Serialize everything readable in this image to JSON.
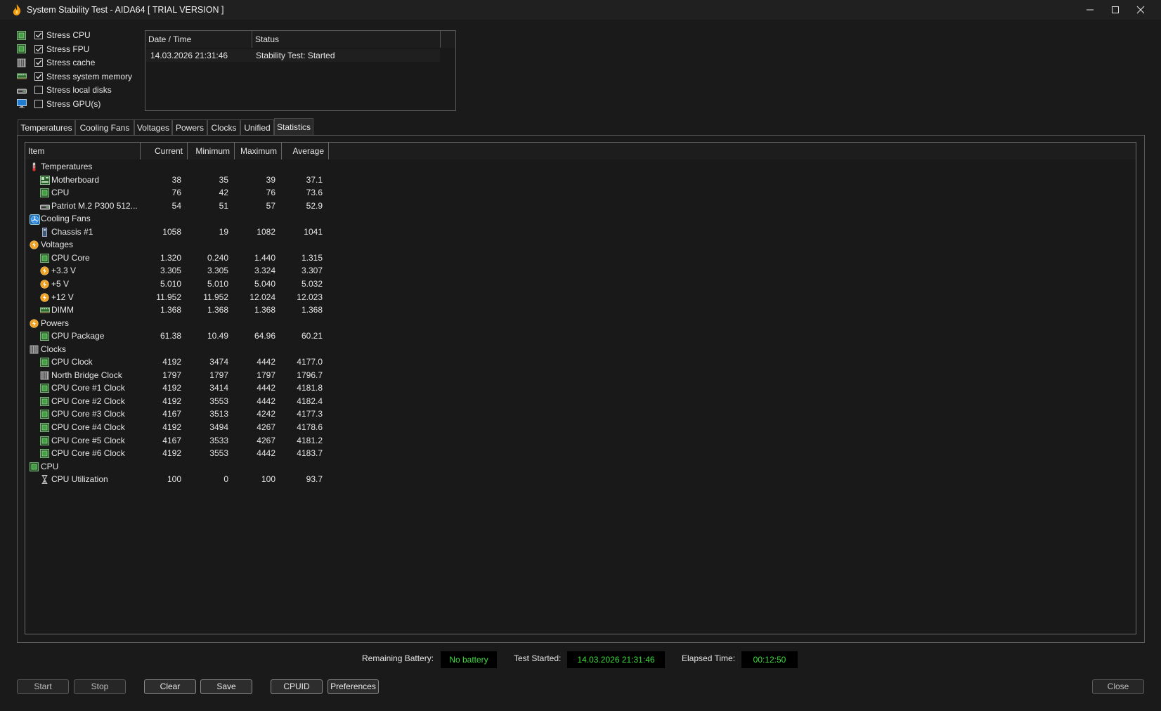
{
  "window": {
    "title": "System Stability Test - AIDA64  [ TRIAL VERSION ]"
  },
  "stress_options": [
    {
      "label": "Stress CPU",
      "checked": true,
      "icon": "cpu-chip-icon"
    },
    {
      "label": "Stress FPU",
      "checked": true,
      "icon": "fpu-chip-icon"
    },
    {
      "label": "Stress cache",
      "checked": true,
      "icon": "cache-icon"
    },
    {
      "label": "Stress system memory",
      "checked": true,
      "icon": "memory-module-icon"
    },
    {
      "label": "Stress local disks",
      "checked": false,
      "icon": "disk-drive-icon"
    },
    {
      "label": "Stress GPU(s)",
      "checked": false,
      "icon": "monitor-icon"
    }
  ],
  "log": {
    "col_datetime": "Date / Time",
    "col_status": "Status",
    "rows": [
      {
        "datetime": "14.03.2026 21:31:46",
        "status": "Stability Test: Started"
      }
    ]
  },
  "tabs": [
    "Temperatures",
    "Cooling Fans",
    "Voltages",
    "Powers",
    "Clocks",
    "Unified",
    "Statistics"
  ],
  "active_tab": "Statistics",
  "stats": {
    "headers": {
      "item": "Item",
      "current": "Current",
      "minimum": "Minimum",
      "maximum": "Maximum",
      "average": "Average"
    },
    "rows": [
      {
        "type": "group",
        "label": "Temperatures",
        "icon": "thermometer-icon"
      },
      {
        "type": "item",
        "label": "Motherboard",
        "icon": "motherboard-icon",
        "current": "38",
        "minimum": "35",
        "maximum": "39",
        "average": "37.1"
      },
      {
        "type": "item",
        "label": "CPU",
        "icon": "cpu-chip-icon",
        "current": "76",
        "minimum": "42",
        "maximum": "76",
        "average": "73.6"
      },
      {
        "type": "item",
        "label": "Patriot M.2 P300 512...",
        "icon": "disk-drive-icon",
        "current": "54",
        "minimum": "51",
        "maximum": "57",
        "average": "52.9"
      },
      {
        "type": "group",
        "label": "Cooling Fans",
        "icon": "fan-icon"
      },
      {
        "type": "item",
        "label": "Chassis #1",
        "icon": "chassis-icon",
        "current": "1058",
        "minimum": "19",
        "maximum": "1082",
        "average": "1041"
      },
      {
        "type": "group",
        "label": "Voltages",
        "icon": "voltage-icon"
      },
      {
        "type": "item",
        "label": "CPU Core",
        "icon": "cpu-chip-icon",
        "current": "1.320",
        "minimum": "0.240",
        "maximum": "1.440",
        "average": "1.315"
      },
      {
        "type": "item",
        "label": "+3.3 V",
        "icon": "voltage-icon",
        "current": "3.305",
        "minimum": "3.305",
        "maximum": "3.324",
        "average": "3.307"
      },
      {
        "type": "item",
        "label": "+5 V",
        "icon": "voltage-icon",
        "current": "5.010",
        "minimum": "5.010",
        "maximum": "5.040",
        "average": "5.032"
      },
      {
        "type": "item",
        "label": "+12 V",
        "icon": "voltage-icon",
        "current": "11.952",
        "minimum": "11.952",
        "maximum": "12.024",
        "average": "12.023"
      },
      {
        "type": "item",
        "label": "DIMM",
        "icon": "memory-module-icon",
        "current": "1.368",
        "minimum": "1.368",
        "maximum": "1.368",
        "average": "1.368"
      },
      {
        "type": "group",
        "label": "Powers",
        "icon": "voltage-icon"
      },
      {
        "type": "item",
        "label": "CPU Package",
        "icon": "cpu-chip-icon",
        "current": "61.38",
        "minimum": "10.49",
        "maximum": "64.96",
        "average": "60.21"
      },
      {
        "type": "group",
        "label": "Clocks",
        "icon": "clock-chip-icon"
      },
      {
        "type": "item",
        "label": "CPU Clock",
        "icon": "cpu-chip-icon",
        "current": "4192",
        "minimum": "3474",
        "maximum": "4442",
        "average": "4177.0"
      },
      {
        "type": "item",
        "label": "North Bridge Clock",
        "icon": "clock-chip-icon",
        "current": "1797",
        "minimum": "1797",
        "maximum": "1797",
        "average": "1796.7"
      },
      {
        "type": "item",
        "label": "CPU Core #1 Clock",
        "icon": "cpu-chip-icon",
        "current": "4192",
        "minimum": "3414",
        "maximum": "4442",
        "average": "4181.8"
      },
      {
        "type": "item",
        "label": "CPU Core #2 Clock",
        "icon": "cpu-chip-icon",
        "current": "4192",
        "minimum": "3553",
        "maximum": "4442",
        "average": "4182.4"
      },
      {
        "type": "item",
        "label": "CPU Core #3 Clock",
        "icon": "cpu-chip-icon",
        "current": "4167",
        "minimum": "3513",
        "maximum": "4242",
        "average": "4177.3"
      },
      {
        "type": "item",
        "label": "CPU Core #4 Clock",
        "icon": "cpu-chip-icon",
        "current": "4192",
        "minimum": "3494",
        "maximum": "4267",
        "average": "4178.6"
      },
      {
        "type": "item",
        "label": "CPU Core #5 Clock",
        "icon": "cpu-chip-icon",
        "current": "4167",
        "minimum": "3533",
        "maximum": "4267",
        "average": "4181.2"
      },
      {
        "type": "item",
        "label": "CPU Core #6 Clock",
        "icon": "cpu-chip-icon",
        "current": "4192",
        "minimum": "3553",
        "maximum": "4442",
        "average": "4183.7"
      },
      {
        "type": "group",
        "label": "CPU",
        "icon": "cpu-chip-icon"
      },
      {
        "type": "item",
        "label": "CPU Utilization",
        "icon": "hourglass-icon",
        "current": "100",
        "minimum": "0",
        "maximum": "100",
        "average": "93.7"
      }
    ]
  },
  "status_bar": {
    "battery_label": "Remaining Battery:",
    "battery_value": "No battery",
    "started_label": "Test Started:",
    "started_value": "14.03.2026 21:31:46",
    "elapsed_label": "Elapsed Time:",
    "elapsed_value": "00:12:50"
  },
  "buttons": {
    "start": "Start",
    "stop": "Stop",
    "clear": "Clear",
    "save": "Save",
    "cpuid": "CPUID",
    "preferences": "Preferences",
    "close": "Close"
  },
  "colors": {
    "status_green": "#3ddc3d",
    "chip_green": "#3fa03f",
    "accent_orange": "#f0a020"
  }
}
